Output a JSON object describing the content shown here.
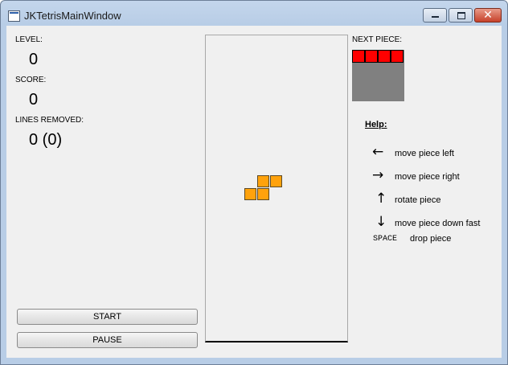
{
  "window": {
    "title": "JKTetrisMainWindow",
    "close_glyph": "✕"
  },
  "stats": {
    "level_label": "LEVEL:",
    "level_value": "0",
    "score_label": "SCORE:",
    "score_value": "0",
    "lines_label": "LINES REMOVED:",
    "lines_value": "0 (0)"
  },
  "buttons": {
    "start": "START",
    "pause": "PAUSE"
  },
  "board": {
    "active_piece": {
      "type": "S",
      "color": "#ffa20c"
    },
    "background_color": "#f0f0f0"
  },
  "next_piece": {
    "label": "NEXT PIECE:",
    "type": "I",
    "color": "#ff0000",
    "background": "#808080"
  },
  "help": {
    "title": "Help:",
    "items": [
      {
        "icon": "arrow-left-icon",
        "symbol": "←",
        "text": "move piece left"
      },
      {
        "icon": "arrow-right-icon",
        "symbol": "→",
        "text": "move piece right"
      },
      {
        "icon": "arrow-up-icon",
        "symbol": "↑",
        "text": "rotate piece"
      },
      {
        "icon": "arrow-down-icon",
        "symbol": "↓",
        "text": "move piece down fast"
      }
    ],
    "space_key": "SPACE",
    "space_text": "drop piece"
  }
}
